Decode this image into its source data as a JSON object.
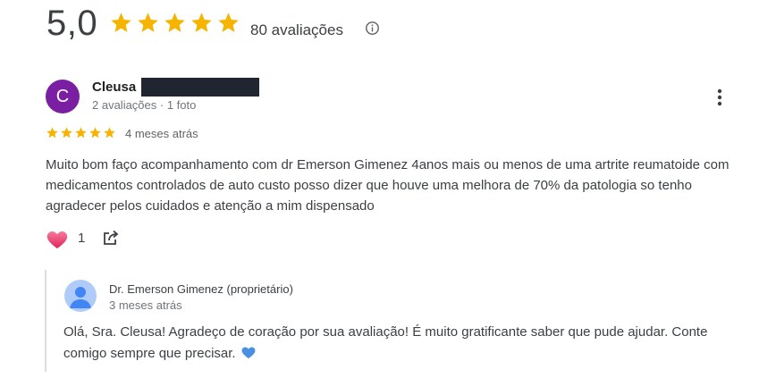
{
  "summary": {
    "rating": "5,0",
    "stars_filled": 5,
    "review_count_label": "80 avaliações",
    "star_color": "#f4b400"
  },
  "review": {
    "avatar_letter": "C",
    "avatar_color": "#7b1fa2",
    "reviewer_name": "Cleusa",
    "reviewer_meta": "2 avaliações · 1 foto",
    "stars_filled": 5,
    "date": "4 meses atrás",
    "text": "Muito bom faço acompanhamento com dr Emerson Gimenez 4anos mais ou menos de uma artrite reumatoide com medicamentos controlados de auto custo posso dizer que houve uma melhora de 70% da patologia so tenho agradecer pelos cuidados e atenção a mim dispensado",
    "like_count": "1"
  },
  "owner_reply": {
    "name": "Dr. Emerson Gimenez (proprietário)",
    "date": "3 meses atrás",
    "text": "Olá, Sra. Cleusa! Agradeço de coração por sua avaliação! É muito gratificante saber que pude ajudar. Conte comigo sempre que precisar."
  },
  "icons": {
    "info": "info-icon",
    "more": "more-vert-icon",
    "like": "heart-icon",
    "share": "share-icon",
    "reply_emoji": "blue-heart-icon"
  }
}
